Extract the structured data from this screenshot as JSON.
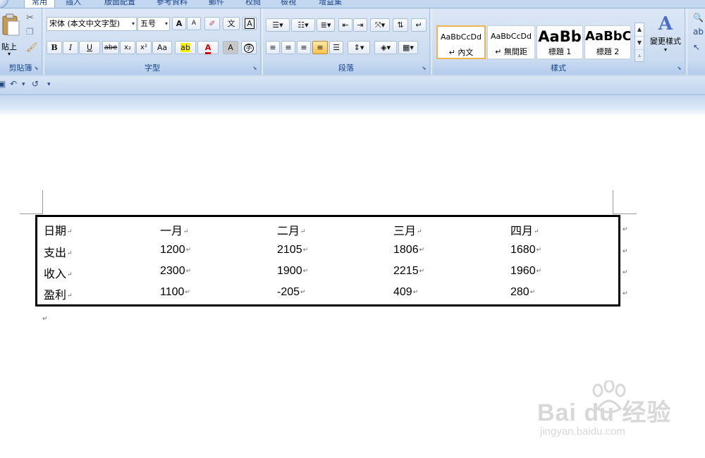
{
  "ribbon": {
    "tabs": [
      "常用",
      "插入",
      "版面配置",
      "參考資料",
      "郵件",
      "校閱",
      "檢視",
      "增益集"
    ],
    "clipboard": {
      "paste_label": "貼上",
      "group_label": "剪貼簿"
    },
    "font": {
      "font_name": "宋体 (本文中文字型)",
      "font_size": "五号",
      "grow_label": "A",
      "shrink_label": "A",
      "bold_label": "B",
      "italic_label": "I",
      "underline_label": "U",
      "strike_label": "abe",
      "subscript_label": "x₂",
      "superscript_label": "x²",
      "case_label": "Aa",
      "highlight_label": "ab",
      "color_label": "A",
      "shade_label": "A",
      "enclose_label": "字",
      "clear_label": "A",
      "group_label": "字型"
    },
    "paragraph": {
      "group_label": "段落"
    },
    "styles": {
      "items": [
        {
          "sample": "AaBbCcDd",
          "name": "↵ 內文"
        },
        {
          "sample": "AaBbCcDd",
          "name": "↵ 無間距"
        },
        {
          "sample": "AaBb",
          "name": "標題 1"
        },
        {
          "sample": "AaBbC",
          "name": "標題 2"
        }
      ],
      "change_label": "變更樣式",
      "group_label": "樣式"
    }
  },
  "quick_access": {
    "undo": "↶",
    "redo": "↺",
    "more": "▾"
  },
  "document": {
    "table": {
      "rows": [
        [
          "日期",
          "一月",
          "二月",
          "三月",
          "四月"
        ],
        [
          "支出",
          "1200",
          "2105",
          "1806",
          "1680"
        ],
        [
          "收入",
          "2300",
          "1900",
          "2215",
          "1960"
        ],
        [
          "盈利",
          "1100",
          "-205",
          "409",
          "280"
        ]
      ]
    },
    "para_mark": "↵"
  },
  "watermark": {
    "brand": "Bai du 经验",
    "url": "jingyan.baidu.com"
  },
  "colors": {
    "ribbon_bg": "#d3e1f3",
    "group_label": "#15428b",
    "selected_style_border": "#f0b64b"
  }
}
